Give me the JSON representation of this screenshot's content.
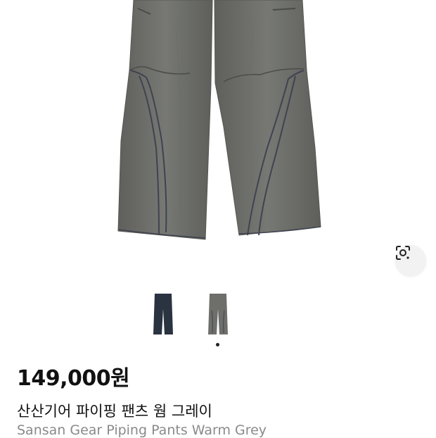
{
  "product": {
    "price": "149,000원",
    "title_ko": "산산기어 파이핑 팬츠 웜 그레이",
    "title_en": "Sansan Gear Piping Pants Warm Grey"
  },
  "gallery": {
    "thumbnails": [
      {
        "color_name": "navy",
        "color": "#2a3340"
      },
      {
        "color_name": "warm-grey",
        "color": "#6e6f6b"
      }
    ],
    "selected_index": 1,
    "main_pants_color": "#6f706c",
    "piping_color": "#3f4350"
  },
  "lens_button": {
    "icon": "visual-search-icon"
  }
}
